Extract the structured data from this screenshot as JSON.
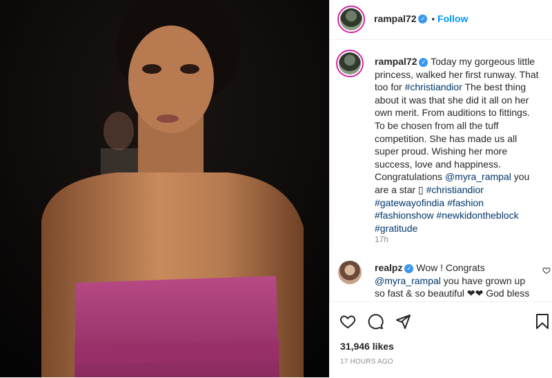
{
  "post": {
    "author": "rampal72",
    "follow_label": "Follow",
    "separator": "•",
    "caption_intro": "Today my gorgeous little princess, walked her first runway. That too for ",
    "tag_christiandior_1": "#christiandior",
    "caption_mid": " The best thing about it was that she did it all on her own merit. From auditions to fittings. To be chosen from all the tuff competition. She has made us all super proud. Wishing her more success, love and happiness. Congratulations ",
    "mention_myra": "@myra_rampal",
    "caption_end": " you are a star ",
    "emoji_placeholder": "▯",
    "tags": [
      "#christiandior",
      "#gatewayofindia",
      "#fashion",
      "#fashionshow",
      "#newkidontheblock",
      "#gratitude"
    ],
    "time_ago": "17h",
    "likes": "31,946 likes",
    "posted": "17 HOURS AGO"
  },
  "comment": {
    "author": "realpz",
    "text_start": "Wow ! Congrats",
    "mention": "@myra_rampal",
    "text_end": " you have grown up so fast & so beautiful ❤❤ God bless"
  },
  "icons": {
    "verified": "verified-badge-icon",
    "like": "heart-icon",
    "comment": "comment-icon",
    "share": "paper-plane-icon",
    "save": "bookmark-icon"
  }
}
